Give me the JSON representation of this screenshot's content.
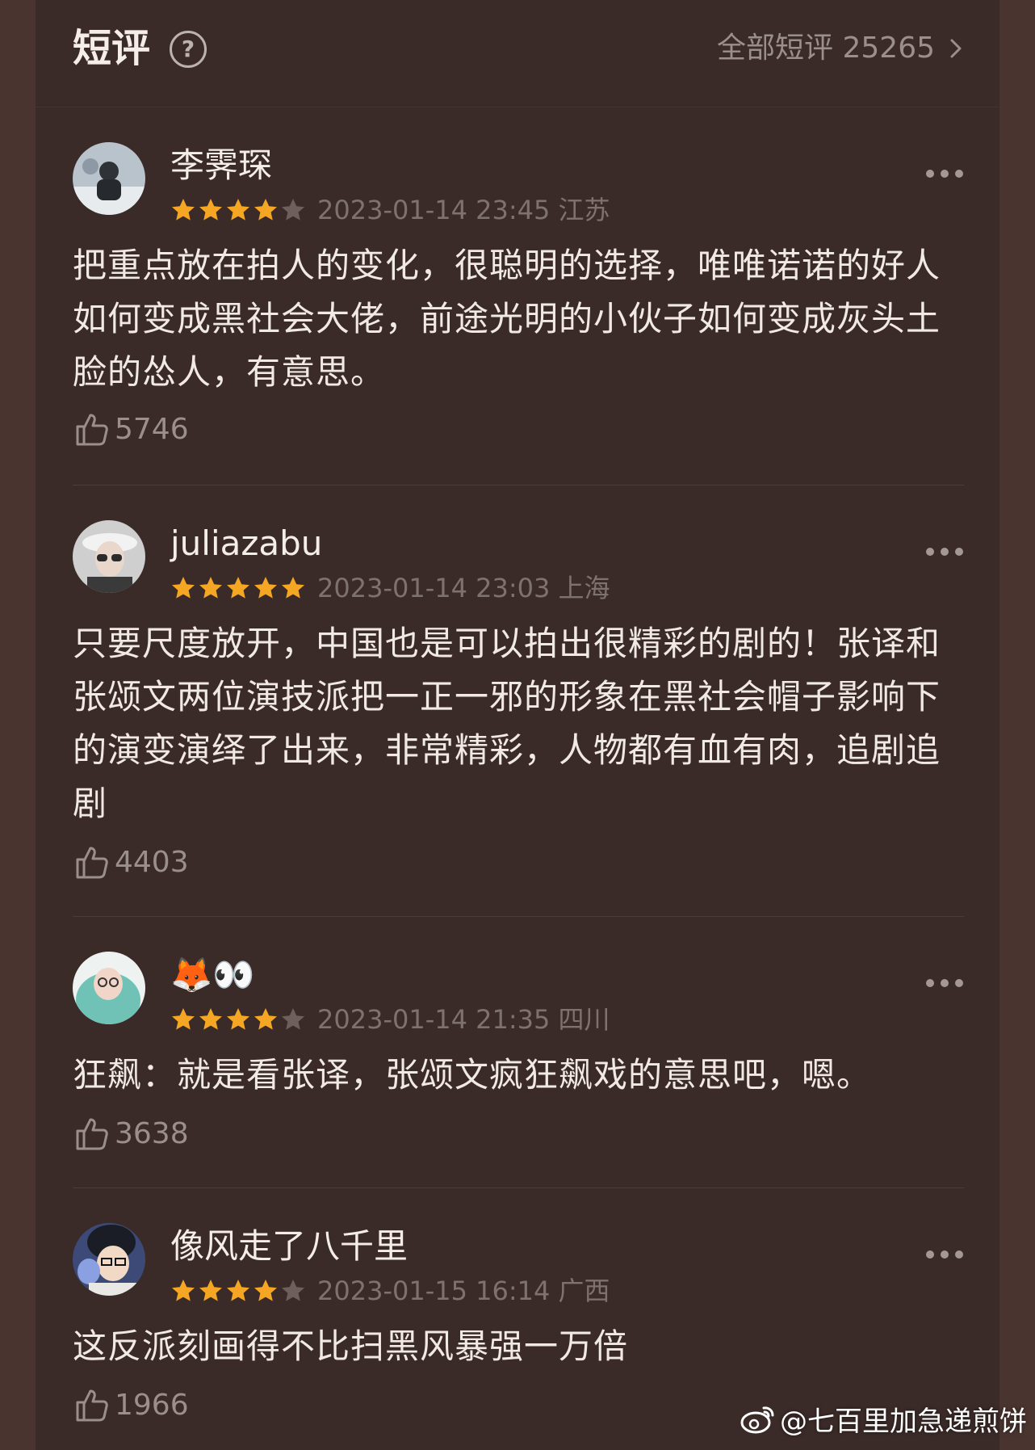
{
  "header": {
    "title": "短评",
    "help_icon": "question-circle-icon",
    "all_label": "全部短评 25265"
  },
  "reviews": [
    {
      "username": "李霁琛",
      "rating": 4,
      "meta": "2023-01-14 23:45 江苏",
      "content": "把重点放在拍人的变化，很聪明的选择，唯唯诺诺的好人如何变成黑社会大佬，前途光明的小伙子如何变成灰头土脸的怂人，有意思。",
      "likes": "5746",
      "avatar_colors": [
        "#9aa6b2",
        "#2f3338"
      ]
    },
    {
      "username": "juliazabu",
      "rating": 5,
      "meta": "2023-01-14 23:03 上海",
      "content": "只要尺度放开，中国也是可以拍出很精彩的剧的！张译和张颂文两位演技派把一正一邪的形象在黑社会帽子影响下的演变演绎了出来，非常精彩，人物都有血有肉，追剧追剧",
      "likes": "4403",
      "avatar_colors": [
        "#d8d8d8",
        "#3a3a3a"
      ]
    },
    {
      "username": "🦊👀",
      "rating": 4,
      "meta": "2023-01-14 21:35 四川",
      "content": "狂飙：就是看张译，张颂文疯狂飙戏的意思吧，嗯。",
      "likes": "3638",
      "avatar_colors": [
        "#bfe0dc",
        "#5fb3a8"
      ]
    },
    {
      "username": "像风走了八千里",
      "rating": 4,
      "meta": "2023-01-15 16:14 广西",
      "content": "这反派刻画得不比扫黑风暴强一万倍",
      "likes": "1966",
      "avatar_colors": [
        "#6b7fb0",
        "#1e2233"
      ]
    }
  ],
  "colors": {
    "star_filled": "#f5a623",
    "star_empty": "#6d605c",
    "background": "#4a342f",
    "panel": "#3b2b28"
  },
  "watermark": {
    "icon": "weibo-logo-icon",
    "text": "@七百里加急递煎饼"
  }
}
